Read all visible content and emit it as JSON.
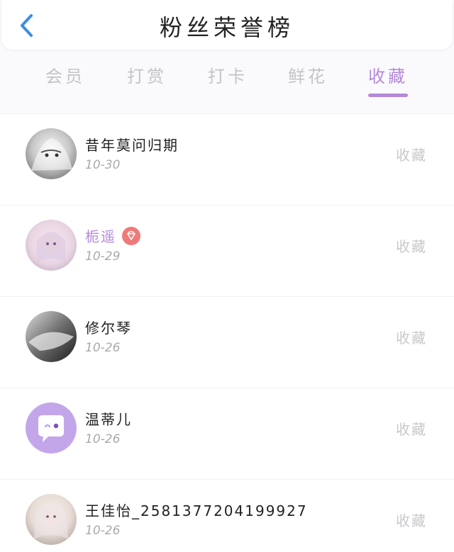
{
  "header": {
    "title": "粉丝荣誉榜",
    "back_icon": "chevron-left-icon",
    "accent": "#3a8ee6"
  },
  "tabs": [
    {
      "label": "会员",
      "active": false
    },
    {
      "label": "打赏",
      "active": false
    },
    {
      "label": "打卡",
      "active": false
    },
    {
      "label": "鲜花",
      "active": false
    },
    {
      "label": "收藏",
      "active": true
    }
  ],
  "colors": {
    "active_tab": "#b48ad8",
    "inactive_tab": "#c4c4c8",
    "vip_name": "#b48ad8",
    "badge": "#ee7a7a"
  },
  "rows": [
    {
      "name": "昔年莫问归期",
      "date": "10-30",
      "action": "收藏",
      "vip": false
    },
    {
      "name": "栀遥",
      "date": "10-29",
      "action": "收藏",
      "vip": true,
      "badge_icon": "diamond-icon"
    },
    {
      "name": "修尔琴",
      "date": "10-26",
      "action": "收藏",
      "vip": false
    },
    {
      "name": "温蒂儿",
      "date": "10-26",
      "action": "收藏",
      "vip": false
    },
    {
      "name": "王佳怡_2581377204199927",
      "date": "10-26",
      "action": "收藏",
      "vip": false
    }
  ]
}
